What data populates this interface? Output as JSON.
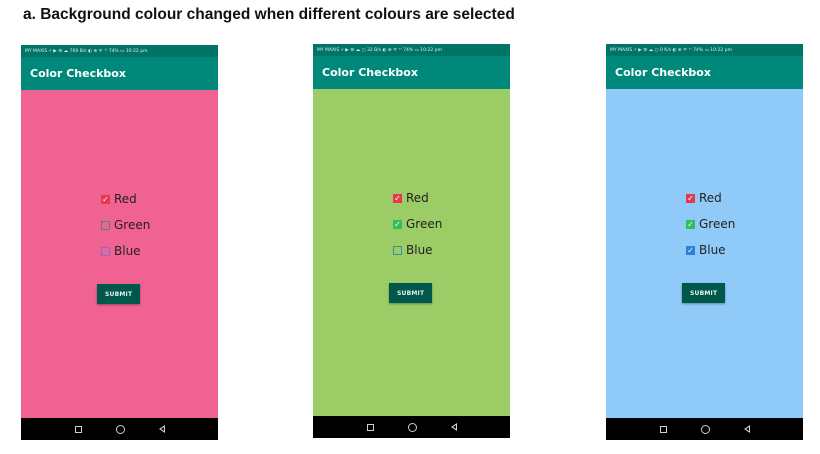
{
  "caption": "a. Background colour changed when different colours are selected",
  "phones": [
    {
      "status_left": "MY MAXIS ⚡ ▶ ⚙ ☁  769 B/s ◐ ⊕ ᯤ ⁺ⁱ 74% ▭ 10:22 pm",
      "app_title": "Color Checkbox",
      "background": "#f06292",
      "checkboxes": [
        {
          "label": "Red",
          "checked": true,
          "color": "#e53950"
        },
        {
          "label": "Green",
          "checked": false,
          "color": "#4e8a5e"
        },
        {
          "label": "Blue",
          "checked": false,
          "color": "#7a6fe0"
        }
      ],
      "submit_label": "SUBMIT"
    },
    {
      "status_left": "MY MAXIS ⚡ ▶ ⚙ ☁ ○  32 B/s ◐ ⊕ ᯤ ⁺ⁱ 74% ▭ 10:22 pm",
      "app_title": "Color Checkbox",
      "background": "#9ccc65",
      "checkboxes": [
        {
          "label": "Red",
          "checked": true,
          "color": "#e53950"
        },
        {
          "label": "Green",
          "checked": true,
          "color": "#2fbf5a"
        },
        {
          "label": "Blue",
          "checked": false,
          "color": "#3a8fa8"
        }
      ],
      "submit_label": "SUBMIT"
    },
    {
      "status_left": "MY MAXIS ⚡ ▶ ⚙ ☁ ○  0 K/s ◐ ⊕ ᯤ ⁺ⁱ 74% ▭ 10:22 pm",
      "app_title": "Color Checkbox",
      "background": "#90caf9",
      "checkboxes": [
        {
          "label": "Red",
          "checked": true,
          "color": "#e53950"
        },
        {
          "label": "Green",
          "checked": true,
          "color": "#2fbf5a"
        },
        {
          "label": "Blue",
          "checked": true,
          "color": "#2f7fd6"
        }
      ],
      "submit_label": "SUBMIT"
    }
  ],
  "colors": {
    "primary": "#00897b",
    "primary_dark": "#007567",
    "button": "#00574b"
  }
}
